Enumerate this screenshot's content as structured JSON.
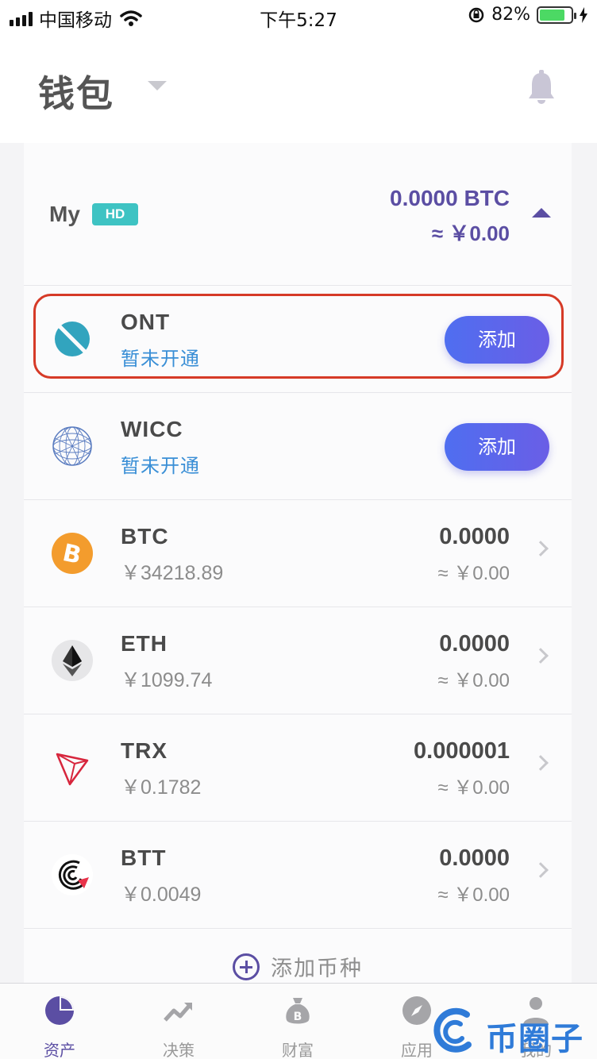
{
  "status_bar": {
    "carrier": "中国移动",
    "time": "下午5:27",
    "battery": "82%",
    "battery_level": 0.82
  },
  "header": {
    "title": "钱包"
  },
  "wallet": {
    "name": "My",
    "badge": "HD",
    "btc_balance": "0.0000 BTC",
    "cny_balance": "≈ ￥0.00"
  },
  "coins": [
    {
      "symbol": "ONT",
      "sub": "暂未开通",
      "action": "添加",
      "icon": "ont-icon"
    },
    {
      "symbol": "WICC",
      "sub": "暂未开通",
      "action": "添加",
      "icon": "wicc-icon"
    },
    {
      "symbol": "BTC",
      "sub": "￥34218.89",
      "balance": "0.0000",
      "approx": "≈ ￥0.00",
      "icon": "btc-icon"
    },
    {
      "symbol": "ETH",
      "sub": "￥1099.74",
      "balance": "0.0000",
      "approx": "≈ ￥0.00",
      "icon": "eth-icon"
    },
    {
      "symbol": "TRX",
      "sub": "￥0.1782",
      "balance": "0.000001",
      "approx": "≈ ￥0.00",
      "icon": "trx-icon"
    },
    {
      "symbol": "BTT",
      "sub": "￥0.0049",
      "balance": "0.0000",
      "approx": "≈ ￥0.00",
      "icon": "btt-icon"
    }
  ],
  "add_coin_label": "添加币种",
  "tabs": [
    {
      "label": "资产",
      "icon": "pie-chart-icon",
      "active": true
    },
    {
      "label": "决策",
      "icon": "trend-icon",
      "active": false
    },
    {
      "label": "财富",
      "icon": "money-bag-icon",
      "active": false
    },
    {
      "label": "应用",
      "icon": "compass-icon",
      "active": false
    },
    {
      "label": "我的",
      "icon": "person-icon",
      "active": false
    }
  ],
  "watermark": "币圈子",
  "colors": {
    "accent": "#5b4ea3",
    "link_blue": "#3a8fd6",
    "button_gradient_start": "#4f6ef0",
    "button_gradient_end": "#6a5ee6",
    "highlight_red": "#d63a27",
    "hd_badge": "#3ec3c3"
  }
}
